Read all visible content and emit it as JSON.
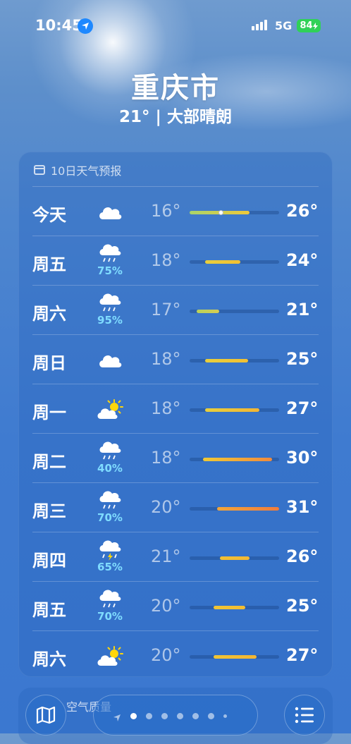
{
  "status_bar": {
    "time": "10:45",
    "network": "5G",
    "battery": "84"
  },
  "location": {
    "city": "重庆市",
    "summary": "21° | 大部晴朗"
  },
  "forecast": {
    "header": "10日天气预报",
    "days": [
      {
        "day": "今天",
        "icon": "cloud-icon",
        "precip": "",
        "low": "16°",
        "high": "26°",
        "bar_start": 0.0,
        "bar_end": 0.67,
        "current_marker": 0.35,
        "bar_colors": [
          "#a8d46a",
          "#f0c93a"
        ]
      },
      {
        "day": "周五",
        "icon": "rain-cloud-icon",
        "precip": "75%",
        "low": "18°",
        "high": "24°",
        "bar_start": 0.17,
        "bar_end": 0.57,
        "bar_colors": [
          "#e9cf3c",
          "#f2c033"
        ]
      },
      {
        "day": "周六",
        "icon": "rain-cloud-icon",
        "precip": "95%",
        "low": "17°",
        "high": "21°",
        "bar_start": 0.08,
        "bar_end": 0.33,
        "bar_colors": [
          "#b9d25a",
          "#d6cc52"
        ]
      },
      {
        "day": "周日",
        "icon": "cloud-icon",
        "precip": "",
        "low": "18°",
        "high": "25°",
        "bar_start": 0.17,
        "bar_end": 0.65,
        "bar_colors": [
          "#e8cf3c",
          "#f2c033"
        ]
      },
      {
        "day": "周一",
        "icon": "partly-sunny-icon",
        "precip": "",
        "low": "18°",
        "high": "27°",
        "bar_start": 0.17,
        "bar_end": 0.78,
        "bar_colors": [
          "#e8cf3c",
          "#f3b533"
        ]
      },
      {
        "day": "周二",
        "icon": "rain-cloud-icon",
        "precip": "40%",
        "low": "18°",
        "high": "30°",
        "bar_start": 0.15,
        "bar_end": 0.92,
        "bar_colors": [
          "#f0ca35",
          "#f08a3d"
        ]
      },
      {
        "day": "周三",
        "icon": "rain-cloud-icon",
        "precip": "70%",
        "low": "20°",
        "high": "31°",
        "bar_start": 0.31,
        "bar_end": 1.0,
        "bar_colors": [
          "#f2a63a",
          "#f07c3d"
        ]
      },
      {
        "day": "周四",
        "icon": "thunder-rain-icon",
        "precip": "65%",
        "low": "21°",
        "high": "26°",
        "bar_start": 0.34,
        "bar_end": 0.67,
        "bar_colors": [
          "#f2c033",
          "#f2b833"
        ]
      },
      {
        "day": "周五",
        "icon": "rain-cloud-icon",
        "precip": "70%",
        "low": "20°",
        "high": "25°",
        "bar_start": 0.27,
        "bar_end": 0.62,
        "bar_colors": [
          "#f0c535",
          "#f2bd33"
        ]
      },
      {
        "day": "周六",
        "icon": "partly-sunny-icon",
        "precip": "",
        "low": "20°",
        "high": "27°",
        "bar_start": 0.27,
        "bar_end": 0.75,
        "bar_colors": [
          "#f0c535",
          "#f3b533"
        ]
      }
    ]
  },
  "next_card": {
    "label": "空气质量"
  },
  "toolbar": {
    "map_icon": "map-icon",
    "list_icon": "list-icon",
    "page_count": 8,
    "active_page": 1
  },
  "colors": {
    "precip": "#7fdcff",
    "battery": "#30d158",
    "location_arrow": "#1e88ff"
  }
}
